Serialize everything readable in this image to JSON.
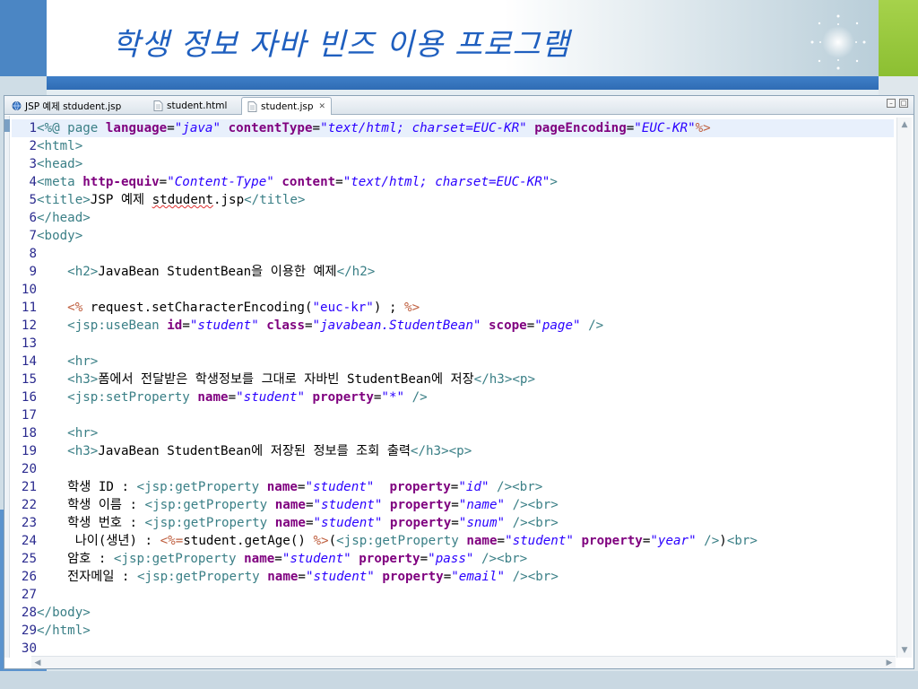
{
  "slide": {
    "title": "학생 정보 자바 빈즈 이용 프로그램",
    "colors": {
      "title": "#1f5fbf",
      "rule": "#2f6cb4",
      "accent_green": "#8cbf32"
    }
  },
  "editor": {
    "tabs": [
      {
        "label": "JSP 예제 stdudent.jsp",
        "icon": "browser-globe-icon",
        "active": false
      },
      {
        "label": "student.html",
        "icon": "file-icon",
        "active": false
      },
      {
        "label": "student.jsp",
        "icon": "file-icon",
        "active": true,
        "close": "✕"
      }
    ],
    "code_lines": [
      {
        "n": "1",
        "html": "<span class=\"t\">&lt;%@ page </span><span class=\"a\">language</span>=<span class=\"v\">\"java\"</span> <span class=\"a\">contentType</span>=<span class=\"v\">\"text/html; charset=EUC-KR\"</span> <span class=\"a\">pageEncoding</span>=<span class=\"v\">\"EUC-KR\"</span><span class=\"d\">%&gt;</span>"
      },
      {
        "n": "2",
        "html": "<span class=\"t\">&lt;html&gt;</span>"
      },
      {
        "n": "3",
        "html": "<span class=\"t\">&lt;head&gt;</span>"
      },
      {
        "n": "4",
        "html": "<span class=\"t\">&lt;meta </span><span class=\"a\">http-equiv</span>=<span class=\"v\">\"Content-Type\"</span> <span class=\"a\">content</span>=<span class=\"v\">\"text/html; charset=EUC-KR\"</span><span class=\"t\">&gt;</span>"
      },
      {
        "n": "5",
        "html": "<span class=\"t\">&lt;title&gt;</span>JSP 예제 <span class=\"spell\">stdudent</span>.jsp<span class=\"t\">&lt;/title&gt;</span>"
      },
      {
        "n": "6",
        "html": "<span class=\"t\">&lt;/head&gt;</span>"
      },
      {
        "n": "7",
        "html": "<span class=\"t\">&lt;body&gt;</span>"
      },
      {
        "n": "8",
        "html": ""
      },
      {
        "n": "9",
        "html": "    <span class=\"t\">&lt;h2&gt;</span>JavaBean StudentBean을 이용한 예제<span class=\"t\">&lt;/h2&gt;</span>"
      },
      {
        "n": "10",
        "html": ""
      },
      {
        "n": "11",
        "html": "    <span class=\"d\">&lt;%</span> request.setCharacterEncoding(<span class=\"v\" style=\"font-style:normal\">\"euc-kr\"</span>)<span> ; </span><span class=\"d\">%&gt;</span>"
      },
      {
        "n": "12",
        "html": "    <span class=\"t\">&lt;jsp:useBean </span><span class=\"a\">id</span>=<span class=\"v\">\"student\"</span> <span class=\"a\">class</span>=<span class=\"v\">\"javabean.StudentBean\"</span> <span class=\"a\">scope</span>=<span class=\"v\">\"page\"</span> <span class=\"t\">/&gt;</span>"
      },
      {
        "n": "13",
        "html": ""
      },
      {
        "n": "14",
        "html": "    <span class=\"t\">&lt;hr&gt;</span>"
      },
      {
        "n": "15",
        "html": "    <span class=\"t\">&lt;h3&gt;</span>폼에서 전달받은 학생정보를 그대로 자바빈 StudentBean에 저장<span class=\"t\">&lt;/h3&gt;&lt;p&gt;</span>"
      },
      {
        "n": "16",
        "html": "    <span class=\"t\">&lt;jsp:setProperty </span><span class=\"a\">name</span>=<span class=\"v\">\"student\"</span> <span class=\"a\">property</span>=<span class=\"v\">\"*\"</span> <span class=\"t\">/&gt;</span>"
      },
      {
        "n": "17",
        "html": ""
      },
      {
        "n": "18",
        "html": "    <span class=\"t\">&lt;hr&gt;</span>"
      },
      {
        "n": "19",
        "html": "    <span class=\"t\">&lt;h3&gt;</span>JavaBean StudentBean에 저장된 정보를 조회 출력<span class=\"t\">&lt;/h3&gt;&lt;p&gt;</span>"
      },
      {
        "n": "20",
        "html": ""
      },
      {
        "n": "21",
        "html": "    학생 ID : <span class=\"t\">&lt;jsp:getProperty </span><span class=\"a\">name</span>=<span class=\"v\">\"student\"</span>  <span class=\"a\">property</span>=<span class=\"v\">\"id\"</span> <span class=\"t\">/&gt;&lt;br&gt;</span>"
      },
      {
        "n": "22",
        "html": "    학생 이름 : <span class=\"t\">&lt;jsp:getProperty </span><span class=\"a\">name</span>=<span class=\"v\">\"student\"</span> <span class=\"a\">property</span>=<span class=\"v\">\"name\"</span> <span class=\"t\">/&gt;&lt;br&gt;</span>"
      },
      {
        "n": "23",
        "html": "    학생 번호 : <span class=\"t\">&lt;jsp:getProperty </span><span class=\"a\">name</span>=<span class=\"v\">\"student\"</span> <span class=\"a\">property</span>=<span class=\"v\">\"snum\"</span> <span class=\"t\">/&gt;&lt;br&gt;</span>"
      },
      {
        "n": "24",
        "html": "     나이(생년) : <span class=\"d\">&lt;%=</span>student.getAge() <span class=\"d\">%&gt;</span>(<span class=\"t\">&lt;jsp:getProperty </span><span class=\"a\">name</span>=<span class=\"v\">\"student\"</span> <span class=\"a\">property</span>=<span class=\"v\">\"year\"</span> <span class=\"t\">/&gt;</span>)<span class=\"t\">&lt;br&gt;</span>"
      },
      {
        "n": "25",
        "html": "    암호 : <span class=\"t\">&lt;jsp:getProperty </span><span class=\"a\">name</span>=<span class=\"v\">\"student\"</span> <span class=\"a\">property</span>=<span class=\"v\">\"pass\"</span> <span class=\"t\">/&gt;&lt;br&gt;</span>"
      },
      {
        "n": "26",
        "html": "    전자메일 : <span class=\"t\">&lt;jsp:getProperty </span><span class=\"a\">name</span>=<span class=\"v\">\"student\"</span> <span class=\"a\">property</span>=<span class=\"v\">\"email\"</span> <span class=\"t\">/&gt;&lt;br&gt;</span>"
      },
      {
        "n": "27",
        "html": ""
      },
      {
        "n": "28",
        "html": "<span class=\"t\">&lt;/body&gt;</span>"
      },
      {
        "n": "29",
        "html": "<span class=\"t\">&lt;/html&gt;</span>"
      },
      {
        "n": "30",
        "html": ""
      }
    ],
    "code_colors": {
      "tag": "#3a7f86",
      "attr": "#7f007f",
      "value": "#2a00ff",
      "directive": "#bf5f3f"
    }
  }
}
